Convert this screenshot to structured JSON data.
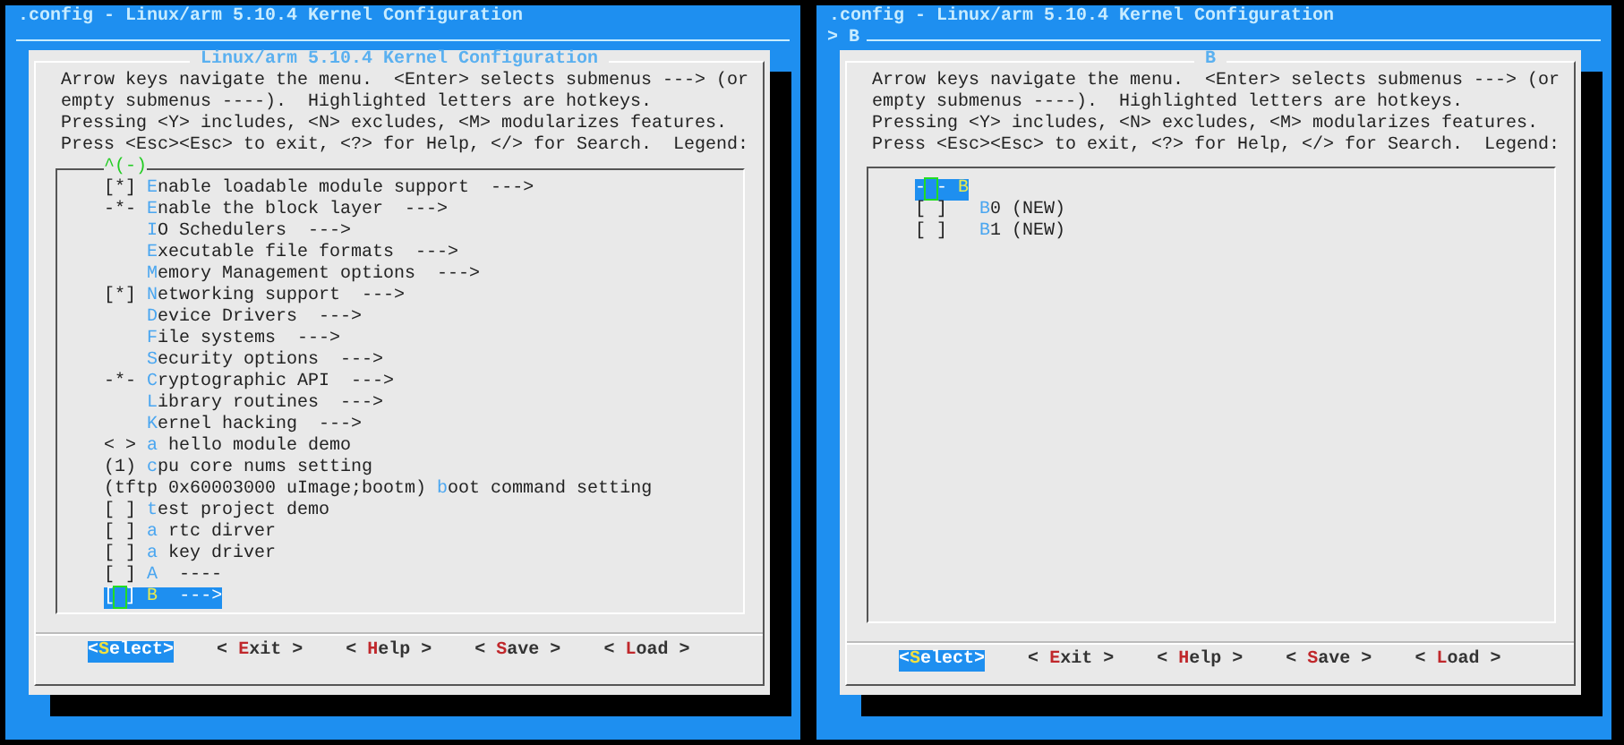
{
  "panes": [
    {
      "title": ".config - Linux/arm 5.10.4 Kernel Configuration",
      "dialog": {
        "title": "Linux/arm 5.10.4 Kernel Configuration",
        "help": [
          "Arrow keys navigate the menu.  <Enter> selects submenus ---> (or",
          "empty submenus ----).  Highlighted letters are hotkeys.",
          "Pressing <Y> includes, <N> excludes, <M> modularizes features.",
          "Press <Esc><Esc> to exit, <?> for Help, </> for Search.  Legend:"
        ],
        "scroll_hint": "^(-)",
        "items": [
          {
            "prefix": "[*]",
            "hotkey": "E",
            "label": "nable loadable module support  --->",
            "selected": false
          },
          {
            "prefix": "-*-",
            "hotkey": "E",
            "label": "nable the block layer  --->",
            "selected": false
          },
          {
            "hotkey": "I",
            "label": "O Schedulers  --->",
            "selected": false
          },
          {
            "hotkey": "E",
            "label": "xecutable file formats  --->",
            "selected": false
          },
          {
            "hotkey": "M",
            "label": "emory Management options  --->",
            "selected": false
          },
          {
            "prefix": "[*]",
            "hotkey": "N",
            "label": "etworking support  --->",
            "selected": false
          },
          {
            "hotkey": "D",
            "label": "evice Drivers  --->",
            "selected": false
          },
          {
            "hotkey": "F",
            "label": "ile systems  --->",
            "selected": false
          },
          {
            "hotkey": "S",
            "label": "ecurity options  --->",
            "selected": false
          },
          {
            "prefix": "-*-",
            "hotkey": "C",
            "label": "ryptographic API  --->",
            "selected": false
          },
          {
            "hotkey": "L",
            "label": "ibrary routines  --->",
            "selected": false
          },
          {
            "hotkey": "K",
            "label": "ernel hacking  --->",
            "selected": false
          },
          {
            "prefix": "< >",
            "hotkey": "a",
            "label": " hello module demo",
            "selected": false
          },
          {
            "prefix": "(1)",
            "hotkey": "c",
            "label": "pu core nums setting",
            "selected": false
          },
          {
            "prefix": "(tftp 0x60003000 uImage;bootm)",
            "hotkey": "b",
            "label": "oot command setting",
            "selected": false
          },
          {
            "prefix": "[ ]",
            "hotkey": "t",
            "label": "est project demo",
            "selected": false
          },
          {
            "prefix": "[ ]",
            "hotkey": "a",
            "label": " rtc dirver",
            "selected": false
          },
          {
            "prefix": "[ ]",
            "hotkey": "a",
            "label": " key driver",
            "selected": false
          },
          {
            "prefix": "[ ]",
            "hotkey": "A",
            "label": "  ----",
            "selected": false
          },
          {
            "prefix": "[ ]",
            "hotkey": "B",
            "label": "  --->",
            "selected": true
          }
        ],
        "buttons": [
          {
            "before": "<",
            "hotkey": "S",
            "after": "elect>",
            "selected": true
          },
          {
            "before": "< ",
            "hotkey": "E",
            "after": "xit >",
            "selected": false
          },
          {
            "before": "< ",
            "hotkey": "H",
            "after": "elp >",
            "selected": false
          },
          {
            "before": "< ",
            "hotkey": "S",
            "after": "ave >",
            "selected": false
          },
          {
            "before": "< ",
            "hotkey": "L",
            "after": "oad >",
            "selected": false
          }
        ]
      }
    },
    {
      "title": ".config - Linux/arm 5.10.4 Kernel Configuration",
      "breadcrumb": "> B",
      "dialog": {
        "title": "B",
        "help": [
          "Arrow keys navigate the menu.  <Enter> selects submenus ---> (or",
          "empty submenus ----).  Highlighted letters are hotkeys.",
          "Pressing <Y> includes, <N> excludes, <M> modularizes features.",
          "Press <Esc><Esc> to exit, <?> for Help, </> for Search.  Legend:"
        ],
        "items": [
          {
            "prefix": "- -",
            "hotkey": "B",
            "selected": true,
            "children": [
              {
                "prefix": "[ ]",
                "hotkey": "B",
                "label": "0 (NEW)",
                "selected": false
              },
              {
                "prefix": "[ ]",
                "hotkey": "B",
                "label": "1 (NEW)",
                "selected": false
              }
            ]
          }
        ],
        "buttons": [
          {
            "before": "<",
            "hotkey": "S",
            "after": "elect>",
            "selected": true
          },
          {
            "before": "< ",
            "hotkey": "E",
            "after": "xit >",
            "selected": false
          },
          {
            "before": "< ",
            "hotkey": "H",
            "after": "elp >",
            "selected": false
          },
          {
            "before": "< ",
            "hotkey": "S",
            "after": "ave >",
            "selected": false
          },
          {
            "before": "< ",
            "hotkey": "L",
            "after": "oad >",
            "selected": false
          }
        ]
      }
    }
  ]
}
